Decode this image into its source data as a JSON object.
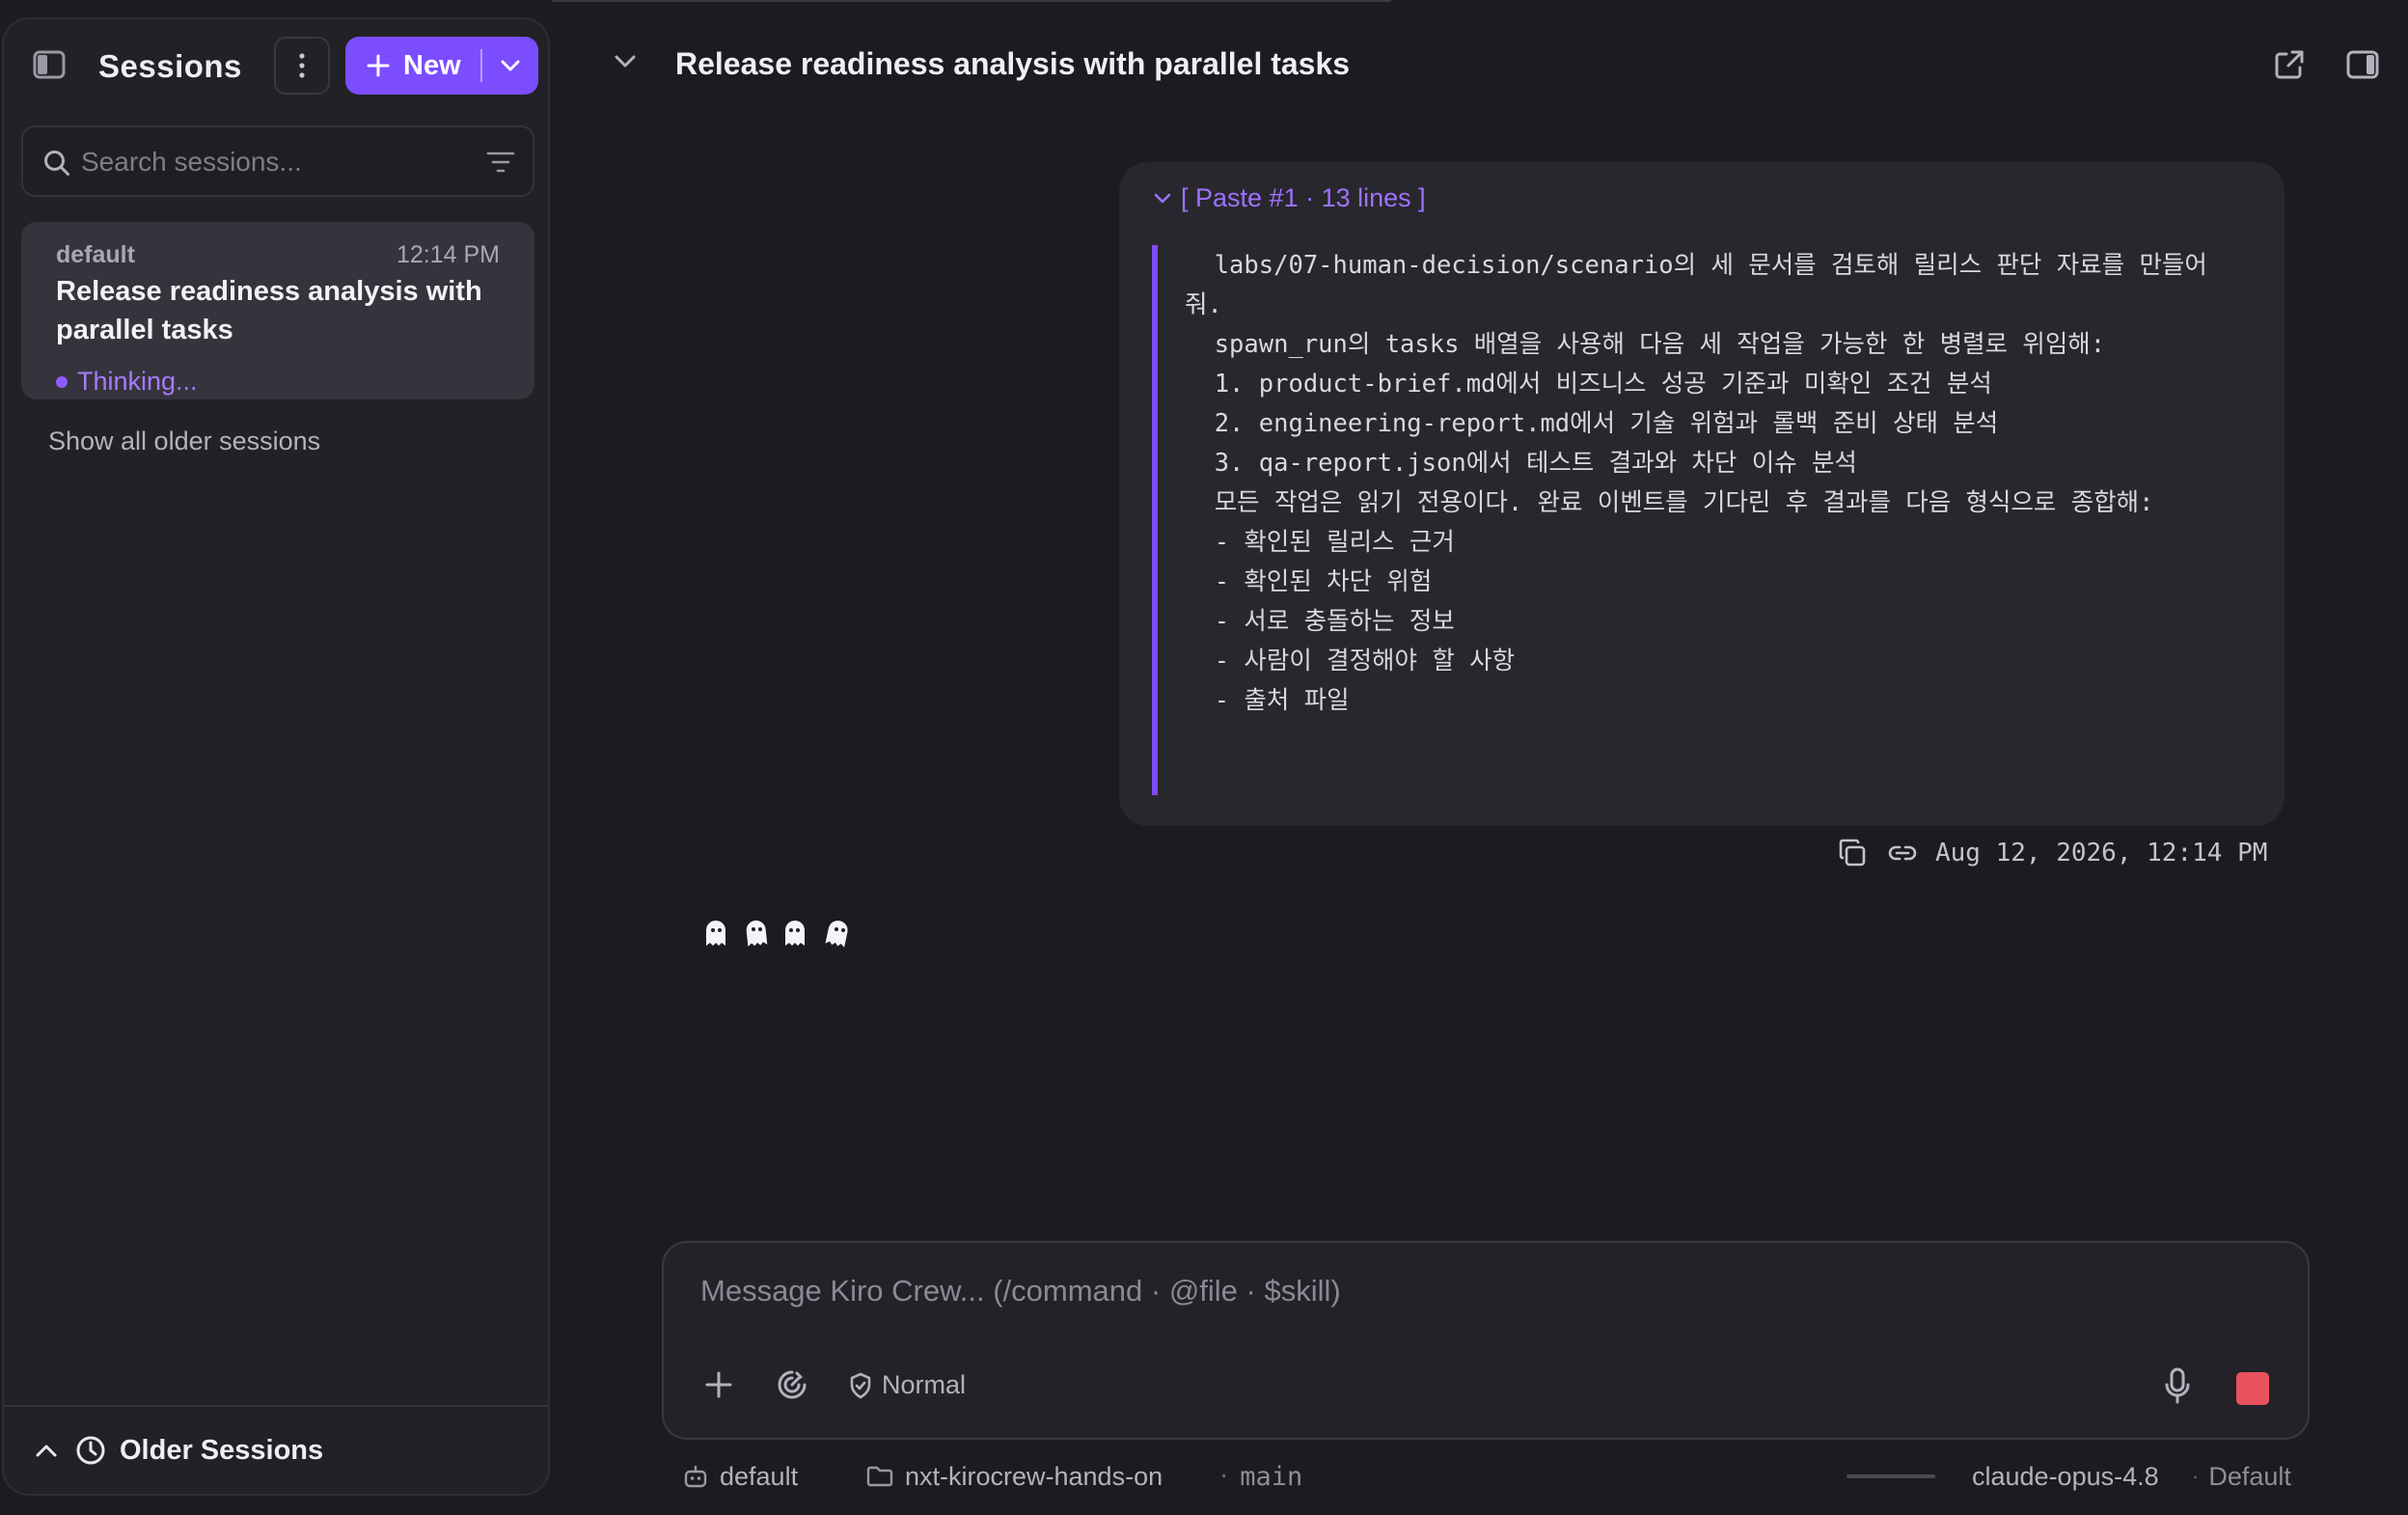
{
  "sidebar": {
    "title": "Sessions",
    "new_label": "New",
    "search_placeholder": "Search sessions...",
    "session": {
      "workspace": "default",
      "time": "12:14 PM",
      "title": "Release readiness analysis with parallel tasks",
      "status": "Thinking..."
    },
    "show_older": "Show all older sessions",
    "footer_label": "Older Sessions"
  },
  "header": {
    "title": "Release readiness analysis with parallel tasks"
  },
  "message": {
    "paste_header": "[ Paste #1 · 13 lines ]",
    "lines": [
      "  labs/07-human-decision/scenario의 세 문서를 검토해 릴리스 판단 자료를 만들어",
      "줘.",
      "  spawn_run의 tasks 배열을 사용해 다음 세 작업을 가능한 한 병렬로 위임해:",
      "  1. product-brief.md에서 비즈니스 성공 기준과 미확인 조건 분석",
      "  2. engineering-report.md에서 기술 위험과 롤백 준비 상태 분석",
      "  3. qa-report.json에서 테스트 결과와 차단 이슈 분석",
      "  모든 작업은 읽기 전용이다. 완료 이벤트를 기다린 후 결과를 다음 형식으로 종합해:",
      "  - 확인된 릴리스 근거",
      "  - 확인된 차단 위험",
      "  - 서로 충돌하는 정보",
      "  - 사람이 결정해야 할 사항",
      "  - 출처 파일"
    ],
    "timestamp": "Aug 12, 2026, 12:14 PM"
  },
  "composer": {
    "placeholder": "Message Kiro Crew... (/command · @file · $skill)",
    "mode": "Normal"
  },
  "statusbar": {
    "agent": "default",
    "folder": "nxt-kirocrew-hands-on",
    "branch": "main",
    "model": "claude-opus-4.8",
    "profile": "Default"
  },
  "colors": {
    "accent": "#7b4dff",
    "stop": "#e8525e",
    "background": "#1c1b20"
  }
}
